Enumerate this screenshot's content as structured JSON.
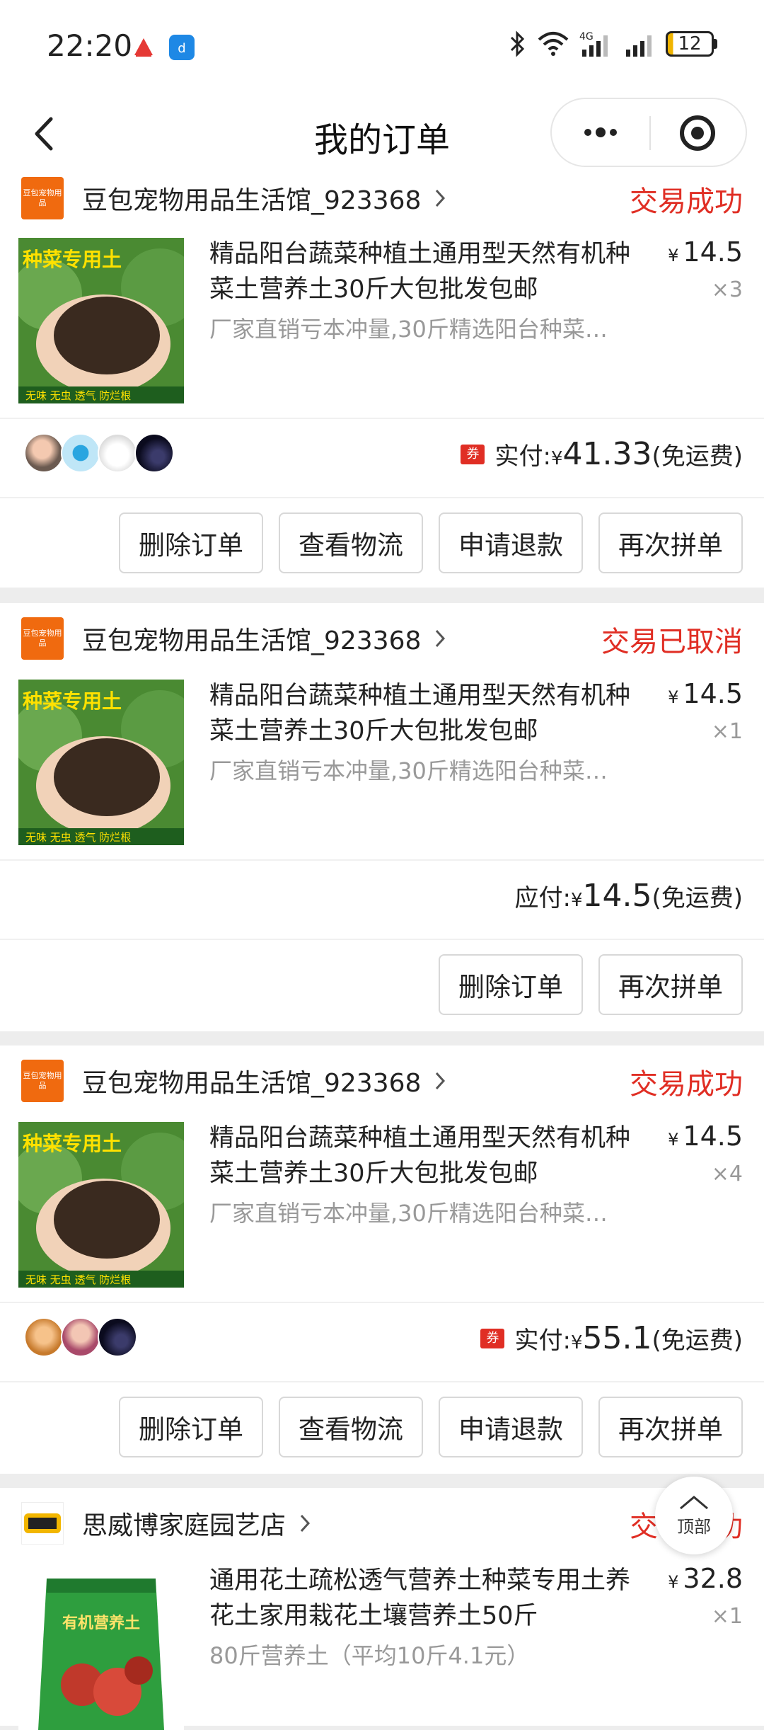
{
  "status_bar": {
    "time": "22:20",
    "battery": "12"
  },
  "nav": {
    "title": "我的订单"
  },
  "orders": [
    {
      "shop_logo_text": "豆包宠物用品",
      "shop_name": "豆包宠物用品生活馆_923368",
      "status": "交易成功",
      "product": {
        "image_banner": "种菜专用土",
        "image_footer": "无味 无虫 透气 防烂根",
        "title": "精品阳台蔬菜种植土通用型天然有机种菜土营养土30斤大包批发包邮",
        "desc": "厂家直销亏本冲量,30斤精选阳台种菜…",
        "price": "14.5",
        "qty": "×3"
      },
      "pay_label": "实付:",
      "pay_amount": "41.33",
      "shipping": "(免运费)",
      "coupon": "券",
      "buttons": [
        "删除订单",
        "查看物流",
        "申请退款",
        "再次拼单"
      ]
    },
    {
      "shop_logo_text": "豆包宠物用品",
      "shop_name": "豆包宠物用品生活馆_923368",
      "status": "交易已取消",
      "product": {
        "image_banner": "种菜专用土",
        "image_footer": "无味 无虫 透气 防烂根",
        "title": "精品阳台蔬菜种植土通用型天然有机种菜土营养土30斤大包批发包邮",
        "desc": "厂家直销亏本冲量,30斤精选阳台种菜…",
        "price": "14.5",
        "qty": "×1"
      },
      "pay_label": "应付:",
      "pay_amount": "14.5",
      "shipping": "(免运费)",
      "buttons": [
        "删除订单",
        "再次拼单"
      ]
    },
    {
      "shop_logo_text": "豆包宠物用品",
      "shop_name": "豆包宠物用品生活馆_923368",
      "status": "交易成功",
      "product": {
        "image_banner": "种菜专用土",
        "image_footer": "无味 无虫 透气 防烂根",
        "title": "精品阳台蔬菜种植土通用型天然有机种菜土营养土30斤大包批发包邮",
        "desc": "厂家直销亏本冲量,30斤精选阳台种菜…",
        "price": "14.5",
        "qty": "×4"
      },
      "pay_label": "实付:",
      "pay_amount": "55.1",
      "shipping": "(免运费)",
      "coupon": "券",
      "buttons": [
        "删除订单",
        "查看物流",
        "申请退款",
        "再次拼单"
      ]
    },
    {
      "shop_name": "思威博家庭园艺店",
      "status": "交易成功",
      "product": {
        "image_banner": "有机营养土",
        "title": "通用花土疏松透气营养土种菜专用土养花土家用栽花土壤营养土50斤",
        "desc": "80斤营养土（平均10斤4.1元）",
        "price": "32.8",
        "qty": "×1"
      }
    }
  ],
  "yen": "¥",
  "top_button": "顶部",
  "colors": {
    "accent_red": "#e02e24",
    "shop_logo_orange": "#f06a0f"
  }
}
